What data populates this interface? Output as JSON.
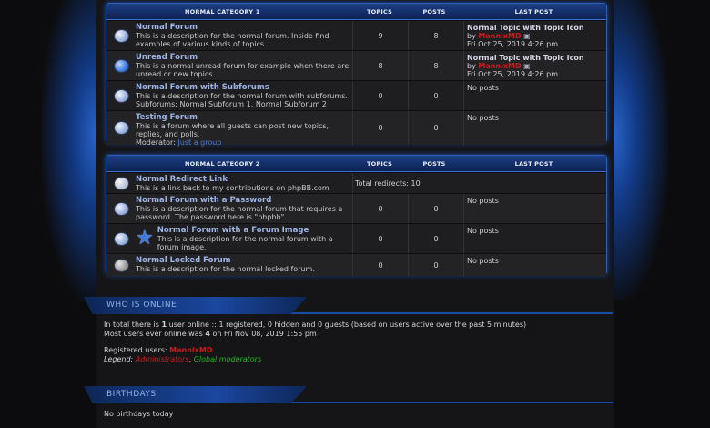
{
  "categories": [
    {
      "title": "NORMAL CATEGORY 1",
      "col_topics": "TOPICS",
      "col_posts": "POSTS",
      "col_last": "LAST POST",
      "forums": [
        {
          "icon": "forum-read-icon",
          "title": "Normal Forum",
          "desc": "This is a description for the normal forum. Inside find examples of various kinds of topics.",
          "topics": "9",
          "posts": "8",
          "last_title": "Normal Topic with Topic Icon",
          "last_by": "by",
          "last_user": "MannixMD",
          "last_date": "Fri Oct 25, 2019 4:26 pm"
        },
        {
          "icon": "forum-unread-icon",
          "title": "Unread Forum",
          "desc": "This is a normal unread forum for example when there are unread or new topics.",
          "topics": "8",
          "posts": "8",
          "last_title": "Normal Topic with Topic Icon",
          "last_by": "by",
          "last_user": "MannixMD",
          "last_date": "Fri Oct 25, 2019 4:26 pm"
        },
        {
          "icon": "forum-subforum-icon",
          "title": "Normal Forum with Subforums",
          "desc": "This is a description for the normal forum with subforums.",
          "subforums_label": "Subforums:",
          "subforum1": "Normal Subforum 1,",
          "subforum2": "Normal Subforum 2",
          "topics": "0",
          "posts": "0",
          "last_none": "No posts"
        },
        {
          "icon": "forum-read-icon",
          "title": "Testing Forum",
          "desc": "This is a forum where all guests can post new topics, replies, and polls.",
          "moderator_label": "Moderator:",
          "moderator": "Just a group",
          "topics": "0",
          "posts": "0",
          "last_none": "No posts"
        }
      ]
    },
    {
      "title": "NORMAL CATEGORY 2",
      "col_topics": "TOPICS",
      "col_posts": "POSTS",
      "col_last": "LAST POST",
      "forums": [
        {
          "icon": "forum-redirect-icon",
          "title": "Normal Redirect Link",
          "desc": "This is a link back to my contributions on phpBB.com",
          "redirects": "Total redirects: 10"
        },
        {
          "icon": "forum-read-icon",
          "title": "Normal Forum with a Password",
          "desc": "This is a description for the normal forum that requires a password. The password here is \"phpbb\".",
          "topics": "0",
          "posts": "0",
          "last_none": "No posts"
        },
        {
          "icon": "forum-image-star-icon",
          "title": "Normal Forum with a Forum Image",
          "desc": "This is a description for the normal forum with a forum image.",
          "topics": "0",
          "posts": "0",
          "last_none": "No posts"
        },
        {
          "icon": "forum-locked-icon",
          "title": "Normal Locked Forum",
          "desc": "This is a description for the normal locked forum.",
          "topics": "0",
          "posts": "0",
          "last_none": "No posts"
        }
      ]
    }
  ],
  "who_is_online": {
    "heading": "WHO IS ONLINE",
    "line1_pre": "In total there is ",
    "line1_num": "1",
    "line1_post": " user online :: 1 registered, 0 hidden and 0 guests (based on users active over the past 5 minutes)",
    "line2_pre": "Most users ever online was ",
    "line2_num": "4",
    "line2_post": " on Fri Nov 08, 2019 1:55 pm",
    "registered_label": "Registered users: ",
    "registered_user": "MannixMD",
    "legend_label": "Legend: ",
    "legend_admin": "Administrators",
    ",": ",",
    "legend_mod": "Global moderators"
  },
  "birthdays": {
    "heading": "BIRTHDAYS",
    "text": "No birthdays today"
  },
  "colors": {
    "accent": "#2b5fb8",
    "link": "#9db4e6",
    "admin": "#cc1a1a",
    "mod": "#1bb81b"
  }
}
